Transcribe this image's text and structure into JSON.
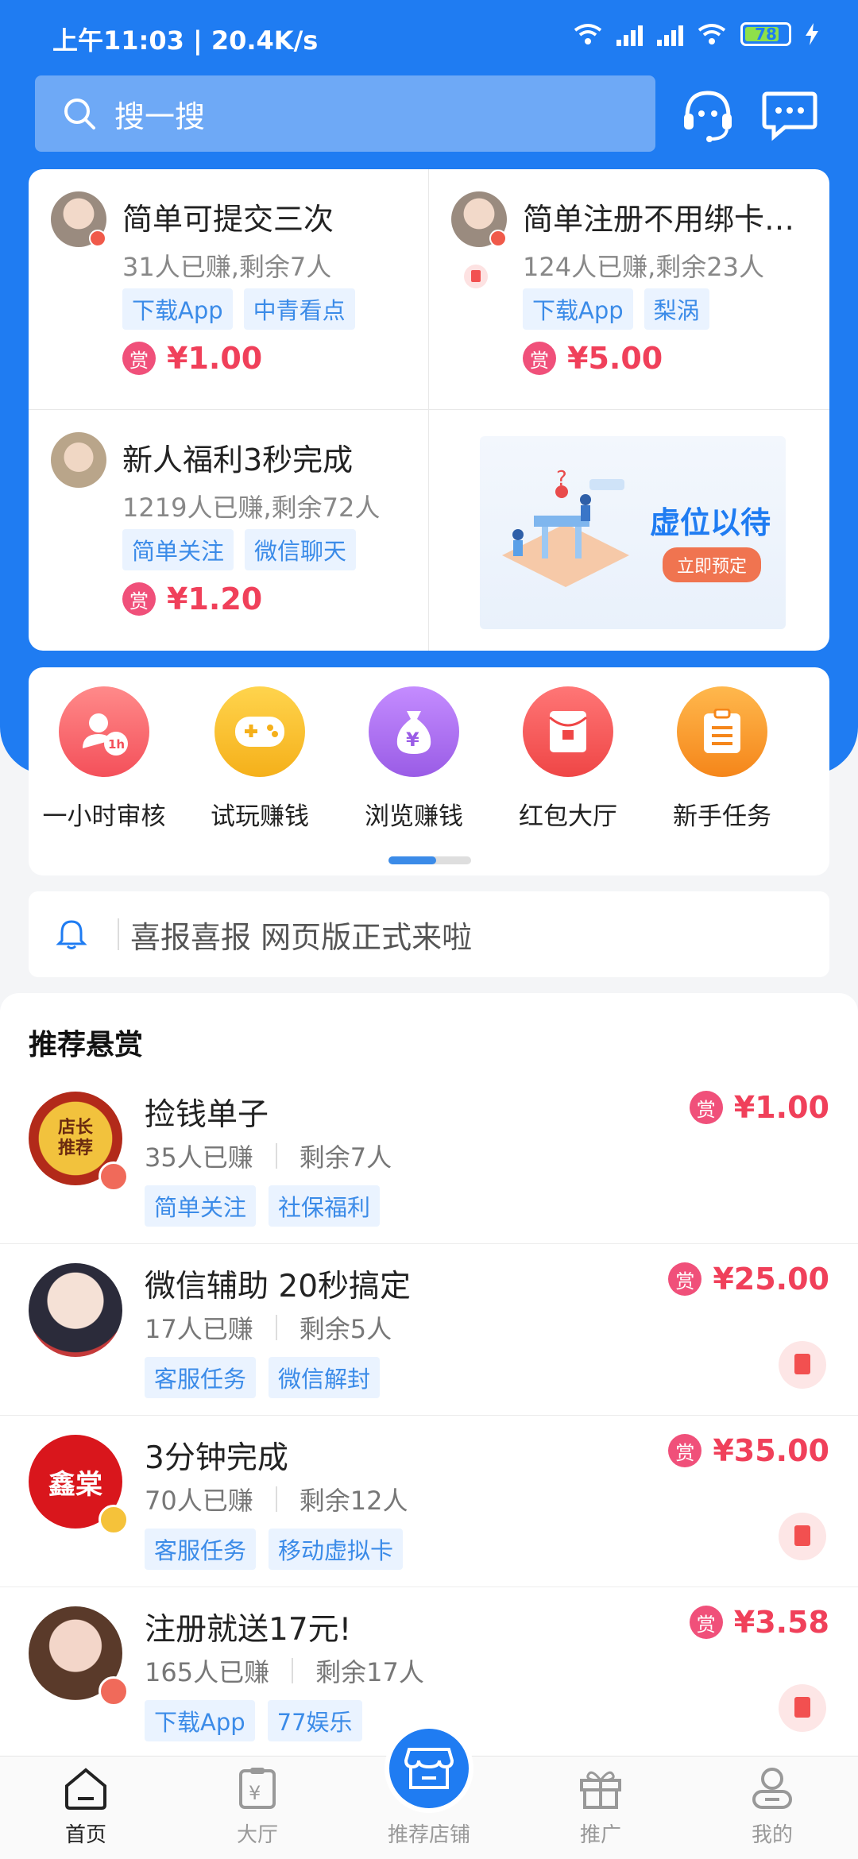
{
  "status": {
    "time": "上午11:03 | 20.4K/s",
    "battery": "78"
  },
  "search": {
    "placeholder": "搜一搜"
  },
  "top_tasks": [
    {
      "title": "简单可提交三次",
      "stats": "31人已赚,剩余7人",
      "tags": [
        "下载App",
        "中青看点"
      ],
      "reward_label": "赏",
      "price": "¥1.00"
    },
    {
      "title": "简单注册不用绑卡…",
      "stats": "124人已赚,剩余23人",
      "tags": [
        "下载App",
        "梨涡"
      ],
      "reward_label": "赏",
      "price": "¥5.00"
    },
    {
      "title": "新人福利3秒完成",
      "stats": "1219人已赚,剩余72人",
      "tags": [
        "简单关注",
        "微信聊天"
      ],
      "reward_label": "赏",
      "price": "¥1.20"
    }
  ],
  "promo": {
    "text": "虚位以待",
    "button": "立即预定"
  },
  "categories": [
    {
      "label": "一小时审核",
      "color": "#f4626a",
      "badge": "1h"
    },
    {
      "label": "试玩赚钱",
      "color": "#f7bf24"
    },
    {
      "label": "浏览赚钱",
      "color": "#a467ee"
    },
    {
      "label": "红包大厅",
      "color": "#f45252"
    },
    {
      "label": "新手任务",
      "color": "#f79a2e"
    }
  ],
  "notice": {
    "text": "喜报喜报 网页版正式来啦"
  },
  "recommend": {
    "heading": "推荐悬赏",
    "items": [
      {
        "title": "捡钱单子",
        "earned": "35人已赚",
        "remaining": "剩余7人",
        "tags": [
          "简单关注",
          "社保福利"
        ],
        "price": "¥1.00",
        "reward_label": "赏",
        "avatar_text": "店长\n推荐"
      },
      {
        "title": "微信辅助 20秒搞定",
        "earned": "17人已赚",
        "remaining": "剩余5人",
        "tags": [
          "客服任务",
          "微信解封"
        ],
        "price": "¥25.00",
        "reward_label": "赏"
      },
      {
        "title": "3分钟完成",
        "earned": "70人已赚",
        "remaining": "剩余12人",
        "tags": [
          "客服任务",
          "移动虚拟卡"
        ],
        "price": "¥35.00",
        "reward_label": "赏",
        "avatar_text": "鑫棠"
      },
      {
        "title": "注册就送17元!",
        "earned": "165人已赚",
        "remaining": "剩余17人",
        "tags": [
          "下载App",
          "77娱乐"
        ],
        "price": "¥3.58",
        "reward_label": "赏"
      }
    ]
  },
  "tabbar": {
    "items": [
      {
        "label": "首页",
        "icon": "home-icon"
      },
      {
        "label": "大厅",
        "icon": "hall-icon"
      },
      {
        "label": "推荐店铺",
        "icon": "shop-icon"
      },
      {
        "label": "推广",
        "icon": "gift-icon"
      },
      {
        "label": "我的",
        "icon": "profile-icon"
      }
    ]
  }
}
